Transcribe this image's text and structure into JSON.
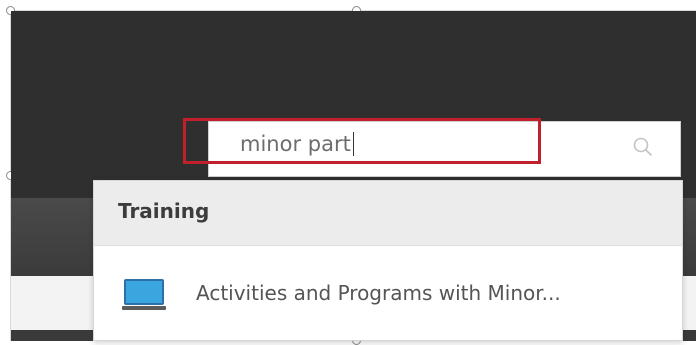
{
  "search": {
    "query": "minor part",
    "icon": "search-icon"
  },
  "dropdown": {
    "section_title": "Training",
    "results": [
      {
        "label": "Activities and Programs with Minor...",
        "icon": "monitor-icon"
      }
    ]
  },
  "colors": {
    "highlight": "#c0202a",
    "header_dark": "#2f2f2f",
    "monitor_screen": "#3aa6e0"
  }
}
